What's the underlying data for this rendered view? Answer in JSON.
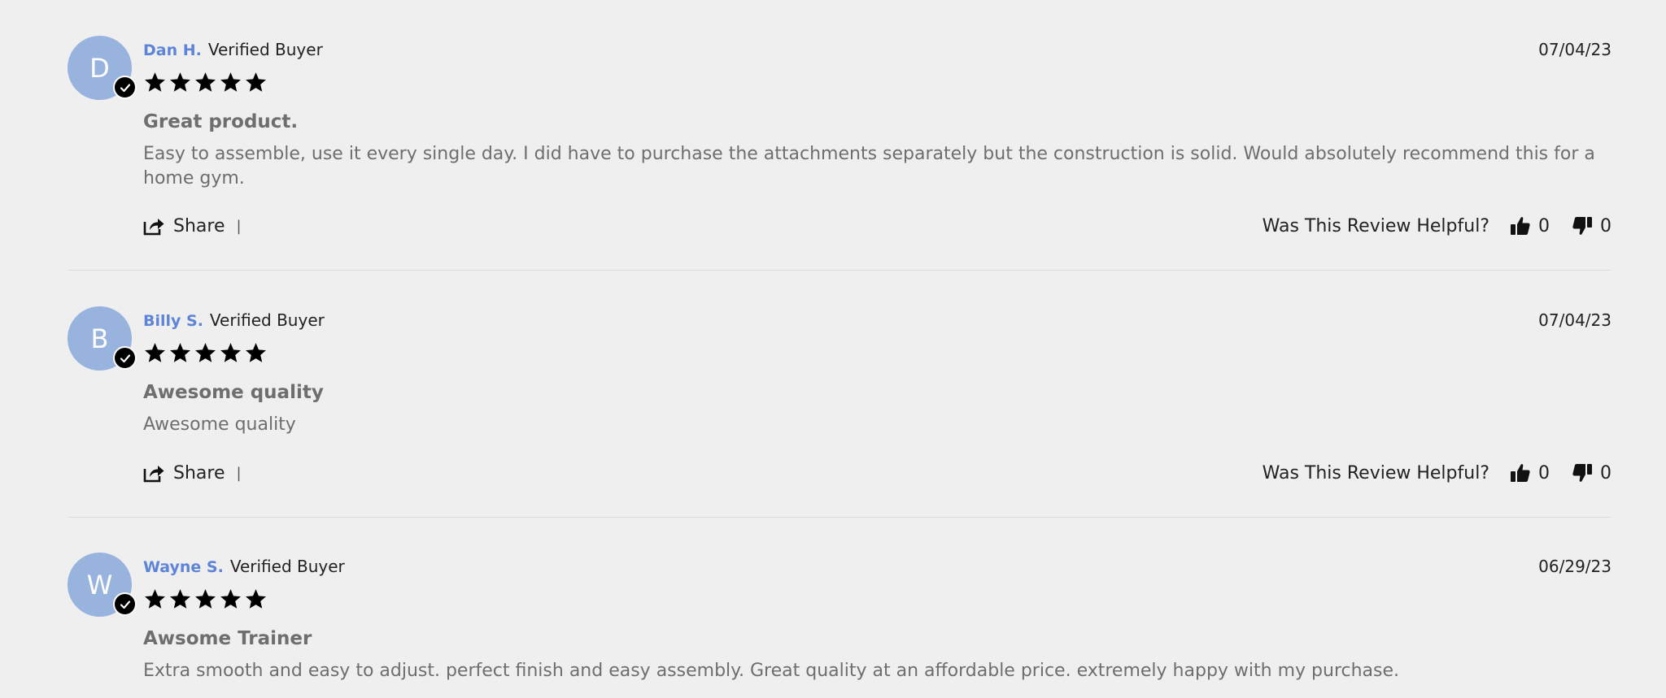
{
  "reviews": [
    {
      "initial": "D",
      "name": "Dan H.",
      "badge": "Verified Buyer",
      "date": "07/04/23",
      "rating": 5,
      "title": "Great product.",
      "body": "Easy to assemble, use it every single day. I did have to purchase the attachments separately but the construction is solid. Would absolutely recommend this for a home gym.",
      "share_label": "Share",
      "separator": "|",
      "helpful_label": "Was This Review Helpful?",
      "upvotes": "0",
      "downvotes": "0"
    },
    {
      "initial": "B",
      "name": "Billy S.",
      "badge": "Verified Buyer",
      "date": "07/04/23",
      "rating": 5,
      "title": "Awesome quality",
      "body": "Awesome quality",
      "share_label": "Share",
      "separator": "|",
      "helpful_label": "Was This Review Helpful?",
      "upvotes": "0",
      "downvotes": "0"
    },
    {
      "initial": "W",
      "name": "Wayne S.",
      "badge": "Verified Buyer",
      "date": "06/29/23",
      "rating": 5,
      "title": "Awsome Trainer",
      "body": "Extra smooth and easy to adjust. perfect finish and easy assembly. Great quality at an affordable price. extremely happy with my purchase."
    }
  ],
  "icons": {
    "verified": "check-circle-icon",
    "star": "star-icon",
    "share": "share-icon",
    "upvote": "thumbs-up-icon",
    "downvote": "thumbs-down-icon"
  },
  "colors": {
    "background": "#efefef",
    "avatar": "#98b3de",
    "reviewer_name": "#5e84d8",
    "muted_text": "#6e6e6e",
    "star": "#000000"
  }
}
